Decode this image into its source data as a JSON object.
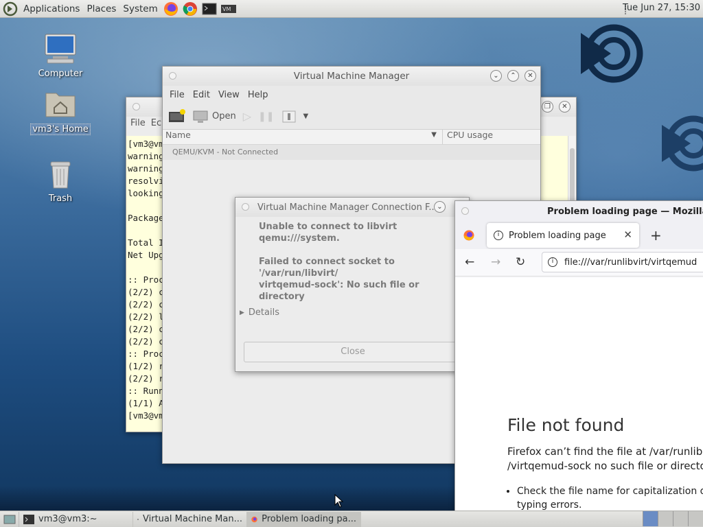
{
  "top_panel": {
    "menus": [
      "Applications",
      "Places",
      "System"
    ],
    "clock": "Tue Jun 27, 15:30",
    "launchers": [
      "firefox-icon",
      "chrome-icon",
      "terminal-icon",
      "vmm-icon"
    ]
  },
  "desktop": {
    "icons": [
      {
        "label": "Computer"
      },
      {
        "label": "vm3's Home"
      },
      {
        "label": "Trash"
      }
    ]
  },
  "terminal": {
    "menu": [
      "File",
      "Ec"
    ],
    "lines": [
      "[vm3@vm",
      "warning",
      "warning",
      "resolvi",
      "looking",
      "",
      "Package",
      "",
      "Total I",
      "Net Upg",
      "",
      ":: Proc",
      "(2/2) c",
      "(2/2) c",
      "(2/2) l",
      "(2/2) c",
      "(2/2) c",
      ":: Proc",
      "(1/2) r",
      "(2/2) r",
      ":: Runn",
      "(1/1) A",
      "[vm3@vm"
    ]
  },
  "vmm": {
    "title": "Virtual Machine Manager",
    "menu": [
      "File",
      "Edit",
      "View",
      "Help"
    ],
    "toolbar": {
      "open": "Open"
    },
    "columns": {
      "name": "Name",
      "cpu": "CPU usage"
    },
    "rows": [
      "QEMU/KVM - Not Connected"
    ]
  },
  "dialog": {
    "title": "Virtual Machine Manager Connection F...",
    "message": "Unable to connect to libvirt qemu:///system.",
    "detail_line1": "Failed to connect socket to '/var/run/libvirt/",
    "detail_line2": "virtqemud-sock': No such file or",
    "detail_line3": "directory",
    "details_label": "Details",
    "close_label": "Close"
  },
  "firefox": {
    "title": "Problem loading page — Mozilla Fire",
    "tab_label": "Problem loading page",
    "url": "file:///var/runlibvirt/virtqemud",
    "heading": "File not found",
    "text_line1": "Firefox can’t find the file at /var/runlib",
    "text_line2": "/virtqemud-sock no such file or directo",
    "bullet1": "Check the file name for capitalization o",
    "bullet1b": "typing errors."
  },
  "taskbar": {
    "tasks": [
      {
        "label": "vm3@vm3:~"
      },
      {
        "label": "Virtual Machine Man..."
      },
      {
        "label": "Problem loading pa..."
      }
    ]
  }
}
